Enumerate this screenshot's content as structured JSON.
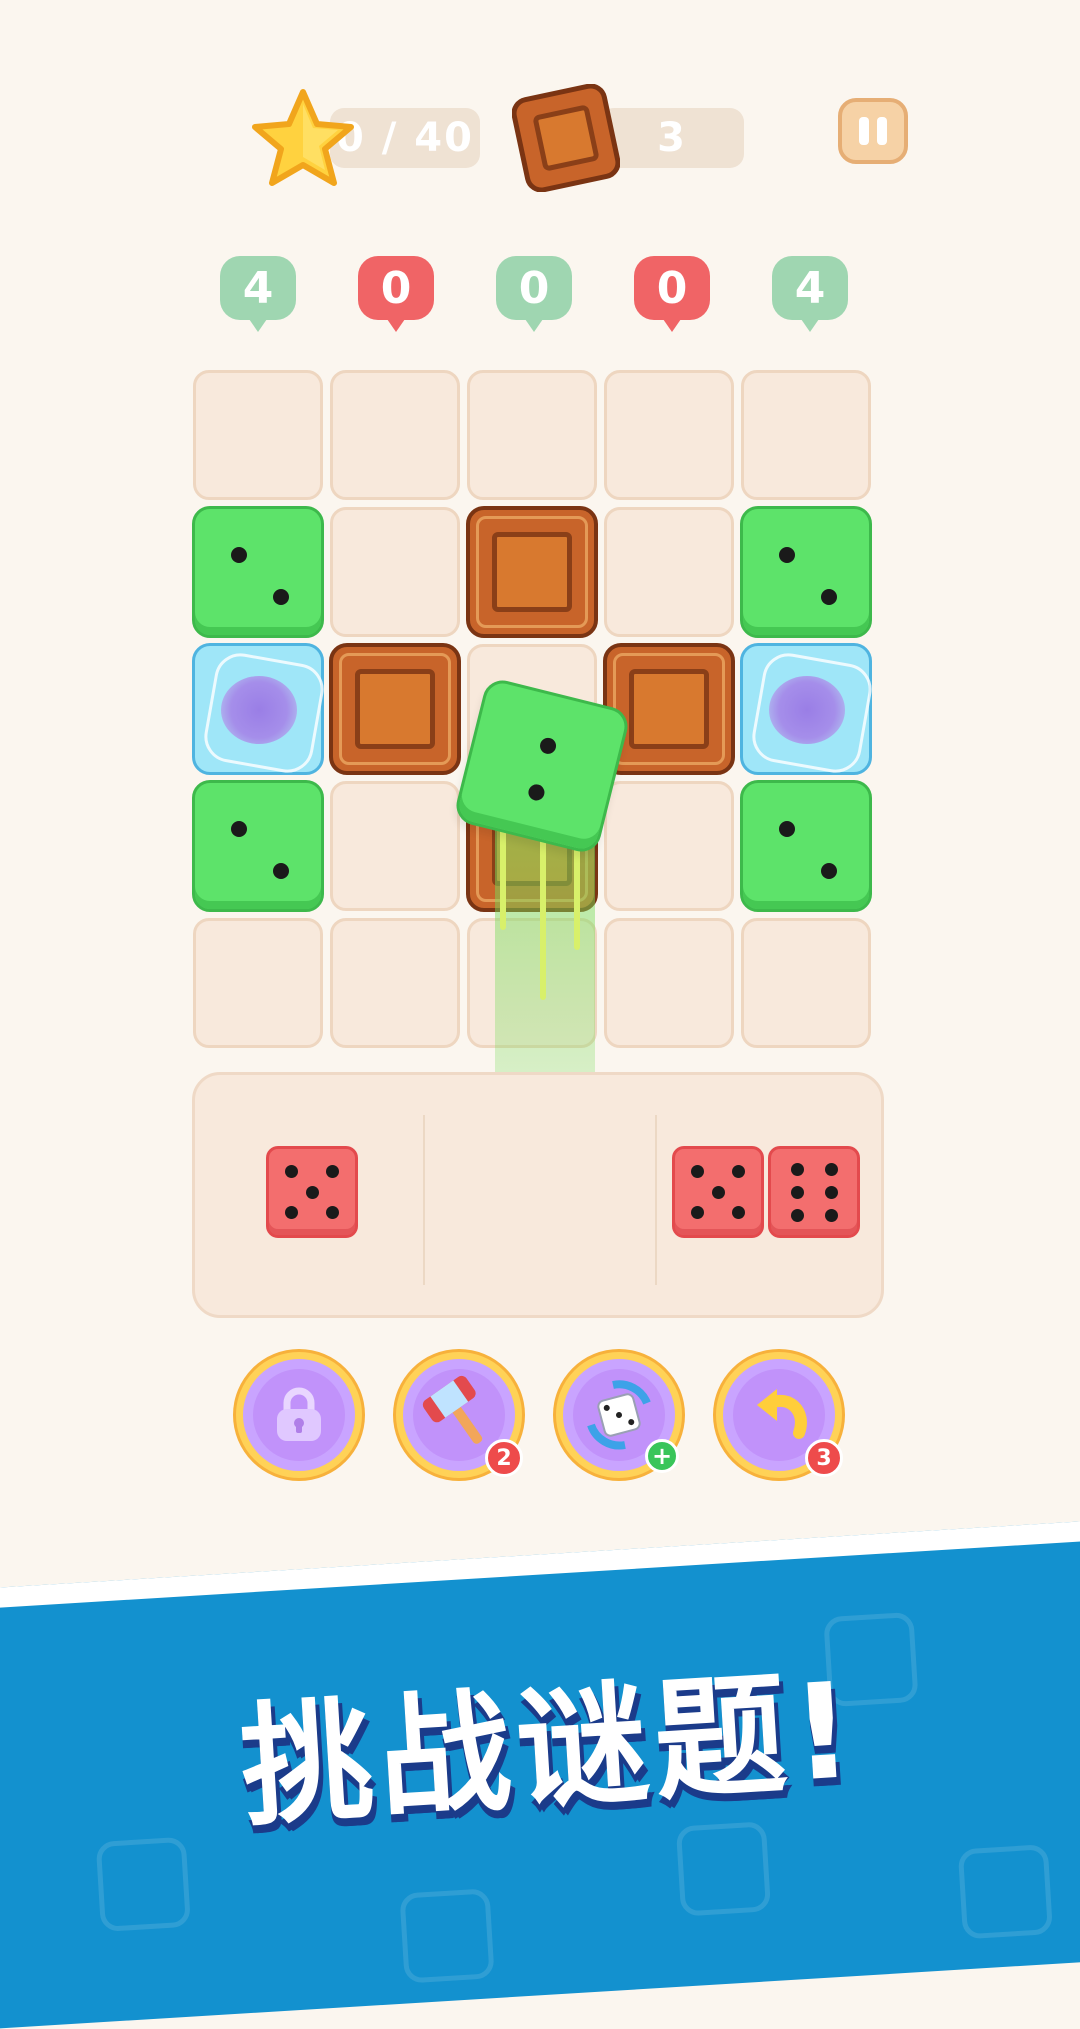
{
  "hud": {
    "star_progress": "0 / 40",
    "crate_remaining": "3"
  },
  "column_badges": [
    {
      "value": "4",
      "color": "green"
    },
    {
      "value": "0",
      "color": "red"
    },
    {
      "value": "0",
      "color": "green"
    },
    {
      "value": "0",
      "color": "red"
    },
    {
      "value": "4",
      "color": "green"
    }
  ],
  "board": {
    "rows": 5,
    "cols": 5,
    "tiles": [
      [
        "empty",
        "empty",
        "empty",
        "empty",
        "empty"
      ],
      [
        "green-dice-2",
        "empty",
        "crate",
        "empty",
        "green-dice-2"
      ],
      [
        "ice",
        "crate",
        "empty",
        "crate",
        "ice"
      ],
      [
        "green-dice-2",
        "empty",
        "crate",
        "empty",
        "green-dice-2"
      ],
      [
        "empty",
        "empty",
        "empty",
        "empty",
        "empty"
      ]
    ]
  },
  "flying_piece": {
    "type": "green-dice",
    "pips": 2
  },
  "tray": {
    "pieces": [
      {
        "slot": 1,
        "dice": [
          5
        ]
      },
      {
        "slot": 2,
        "dice": []
      },
      {
        "slot": 3,
        "dice": [
          5,
          6
        ]
      }
    ]
  },
  "boosters": [
    {
      "name": "lock",
      "count": ""
    },
    {
      "name": "hammer",
      "count": "2"
    },
    {
      "name": "shuffle-dice",
      "count": "+"
    },
    {
      "name": "undo",
      "count": "3"
    }
  ],
  "banner": {
    "text": "挑战谜题!"
  },
  "colors": {
    "background": "#fbf6ef",
    "green_tile": "#5de36a",
    "red_tile": "#f36e6e",
    "crate": "#c8642a",
    "banner": "#1391cf",
    "booster": "#c9a4ff"
  }
}
